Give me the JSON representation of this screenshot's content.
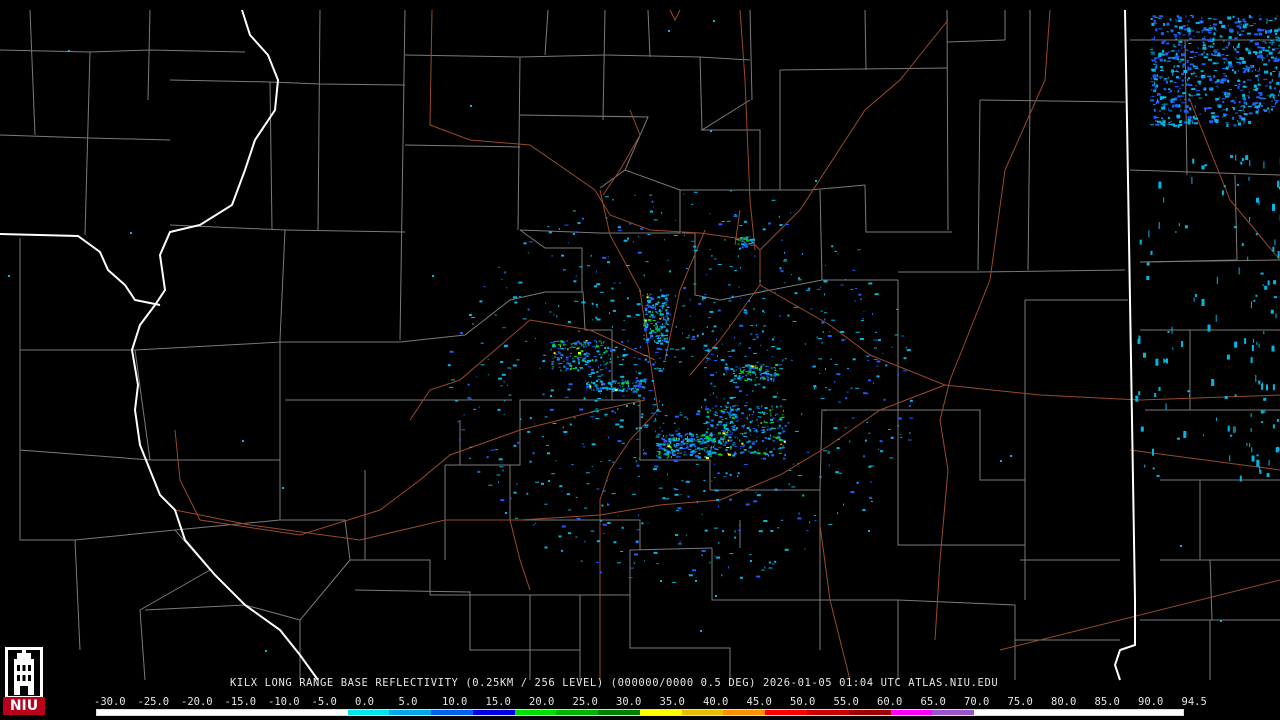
{
  "app": {
    "product": "KILX LONG RANGE BASE REFLECTIVITY (0.25KM / 256 LEVEL) (000000/0000 0.5 DEG) 2026-01-05 01:04 UTC  ATLAS.NIU.EDU"
  },
  "logo": {
    "text": "NIU",
    "icon": "university-tower-icon"
  },
  "scale": {
    "labels": [
      "-30.0",
      "-25.0",
      "-20.0",
      "-15.0",
      "-10.0",
      "-5.0",
      "0.0",
      "5.0",
      "10.0",
      "15.0",
      "20.0",
      "25.0",
      "30.0",
      "35.0",
      "40.0",
      "45.0",
      "50.0",
      "55.0",
      "60.0",
      "65.0",
      "70.0",
      "75.0",
      "80.0",
      "85.0",
      "90.0",
      "94.5"
    ],
    "colors": [
      "#ffffff",
      "#ffffff",
      "#ffffff",
      "#ffffff",
      "#ffffff",
      "#ffffff",
      "#00e5e5",
      "#00a8e8",
      "#0060f0",
      "#0000e0",
      "#00e000",
      "#00b400",
      "#008000",
      "#ffff00",
      "#e6c000",
      "#ff9000",
      "#ff0000",
      "#c80000",
      "#a00000",
      "#ff00ff",
      "#9955c9",
      "#ffffff",
      "#ffffff",
      "#ffffff",
      "#ffffff",
      "#ffffff"
    ]
  },
  "map": {
    "colors": {
      "background": "#000000",
      "county_lines": "#7a7a7a",
      "state_lines": "#ffffff",
      "highways": "#9a4a2a",
      "echo_light": "#00b8e6",
      "echo_mid": "#1e5cff",
      "echo_strong": "#00e000",
      "echo_core": "#ffff00"
    }
  }
}
